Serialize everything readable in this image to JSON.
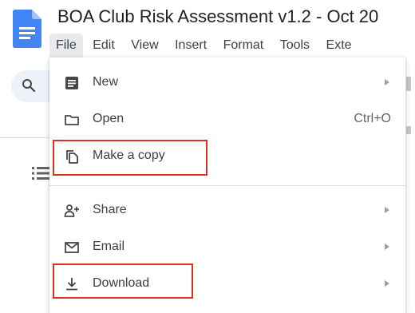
{
  "document": {
    "title": "BOA Club Risk Assessment v1.2 - Oct 20"
  },
  "menubar": {
    "items": [
      {
        "label": "File",
        "active": true
      },
      {
        "label": "Edit"
      },
      {
        "label": "View"
      },
      {
        "label": "Insert"
      },
      {
        "label": "Format"
      },
      {
        "label": "Tools"
      },
      {
        "label": "Exte"
      }
    ]
  },
  "file_menu": {
    "items": [
      {
        "label": "New",
        "icon": "new-document-icon",
        "submenu": true
      },
      {
        "label": "Open",
        "icon": "folder-icon",
        "shortcut": "Ctrl+O"
      },
      {
        "label": "Make a copy",
        "icon": "copy-icon",
        "highlighted": true
      },
      {
        "label": "Share",
        "icon": "share-person-add-icon",
        "submenu": true
      },
      {
        "label": "Email",
        "icon": "email-icon",
        "submenu": true
      },
      {
        "label": "Download",
        "icon": "download-icon",
        "submenu": true,
        "highlighted": true
      }
    ]
  },
  "colors": {
    "highlight_border": "#d93025",
    "docs_blue": "#4285f4",
    "menu_active_bg": "#e8eaed"
  }
}
